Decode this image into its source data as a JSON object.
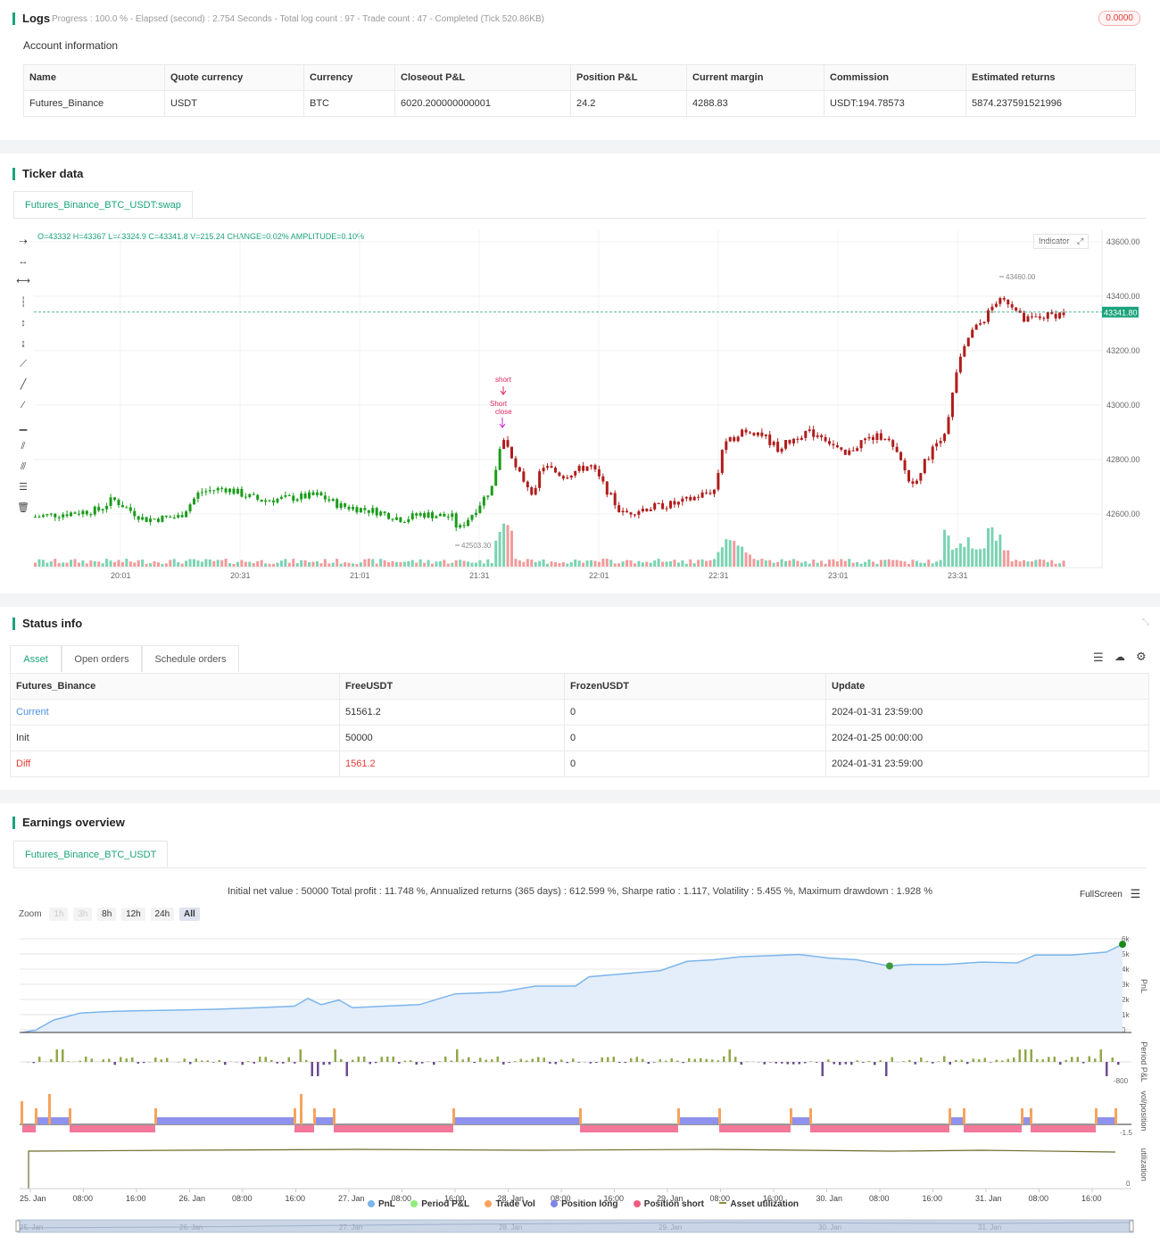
{
  "logs": {
    "title": "Logs",
    "progress_text": "Progress : 100.0 % - Elapsed (second) : 2.754  Seconds - Total log count : 97 - Trade count : 47 - Completed (Tick 520.86KB)",
    "badge": "0.0000",
    "account_heading": "Account information",
    "columns": [
      "Name",
      "Quote currency",
      "Currency",
      "Closeout P&L",
      "Position P&L",
      "Current margin",
      "Commission",
      "Estimated returns"
    ],
    "row": [
      "Futures_Binance",
      "USDT",
      "BTC",
      "6020.200000000001",
      "24.2",
      "4288.83",
      "USDT:194.78573",
      "5874.237591521996"
    ]
  },
  "ticker": {
    "title": "Ticker data",
    "tab": "Futures_Binance_BTC_USDT:swap",
    "ohlc_text": "O=43332 H=43367 L=43324.9 C=43341.8 V=215.24 CHANGE=0.02% AMPLITUDE=0.10%",
    "indicator_label": "Indicator",
    "current_price": "43341.80",
    "max_label": "43460.00",
    "min_label": "42503.30",
    "short_label": "short",
    "short_close_label_1": "Short",
    "short_close_label_2": "close",
    "y_ticks": [
      "43600.00",
      "43400.00",
      "43200.00",
      "43000.00",
      "42800.00",
      "42600.00"
    ],
    "x_ticks": [
      "20:01",
      "20:31",
      "21:01",
      "21:31",
      "22:01",
      "22:31",
      "23:01",
      "23:31"
    ],
    "colors": {
      "up": "#1a9c1a",
      "down": "#b01c1c",
      "vol_up": "#7ad3b2",
      "vol_down": "#f29a9a",
      "accent": "#1aa37a"
    }
  },
  "status": {
    "title": "Status info",
    "tabs": [
      "Asset",
      "Open orders",
      "Schedule orders"
    ],
    "columns": [
      "Futures_Binance",
      "FreeUSDT",
      "FrozenUSDT",
      "Update"
    ],
    "rows": [
      [
        "Current",
        "51561.2",
        "0",
        "2024-01-31 23:59:00"
      ],
      [
        "Init",
        "50000",
        "0",
        "2024-01-25 00:00:00"
      ],
      [
        "Diff",
        "1561.2",
        "0",
        "2024-01-31 23:59:00"
      ]
    ]
  },
  "earnings": {
    "title": "Earnings overview",
    "tab": "Futures_Binance_BTC_USDT",
    "summary": "Initial net value : 50000 Total profit : 11.748 %, Annualized returns (365 days) : 612.599 %, Sharpe ratio : 1.117, Volatility : 5.455 %, Maximum drawdown : 1.928 %",
    "fullscreen": "FullScreen",
    "zoom_label": "Zoom",
    "zoom_buttons": [
      "1h",
      "3h",
      "8h",
      "12h",
      "24h",
      "All"
    ],
    "pnl_ticks": [
      "6k",
      "5k",
      "4k",
      "3k",
      "2k",
      "1k",
      "0"
    ],
    "axis_titles": [
      "PnL",
      "Period P&L",
      "vol/position",
      "utilization"
    ],
    "period_tick": "-800",
    "vol_tick": "-1.5",
    "util_tick": "0",
    "x_ticks": [
      "25. Jan",
      "08:00",
      "16:00",
      "26. Jan",
      "08:00",
      "16:00",
      "27. Jan",
      "08:00",
      "16:00",
      "28. Jan",
      "08:00",
      "16:00",
      "29. Jan",
      "08:00",
      "16:00",
      "30. Jan",
      "08:00",
      "16:00",
      "31. Jan",
      "08:00",
      "16:00"
    ],
    "legend": [
      {
        "name": "PnL",
        "color": "#7cb5ec"
      },
      {
        "name": "Period P&L",
        "color": "#90ed7d"
      },
      {
        "name": "Trade Vol",
        "color": "#f7a35c"
      },
      {
        "name": "Position long",
        "color": "#8085e9"
      },
      {
        "name": "Position short",
        "color": "#f15c80"
      },
      {
        "name": "Asset utilization",
        "color": "#8d8d3a"
      }
    ],
    "navigator_ticks": [
      "25. Jan",
      "26. Jan",
      "27. Jan",
      "28. Jan",
      "29. Jan",
      "30. Jan",
      "31. Jan"
    ]
  }
}
